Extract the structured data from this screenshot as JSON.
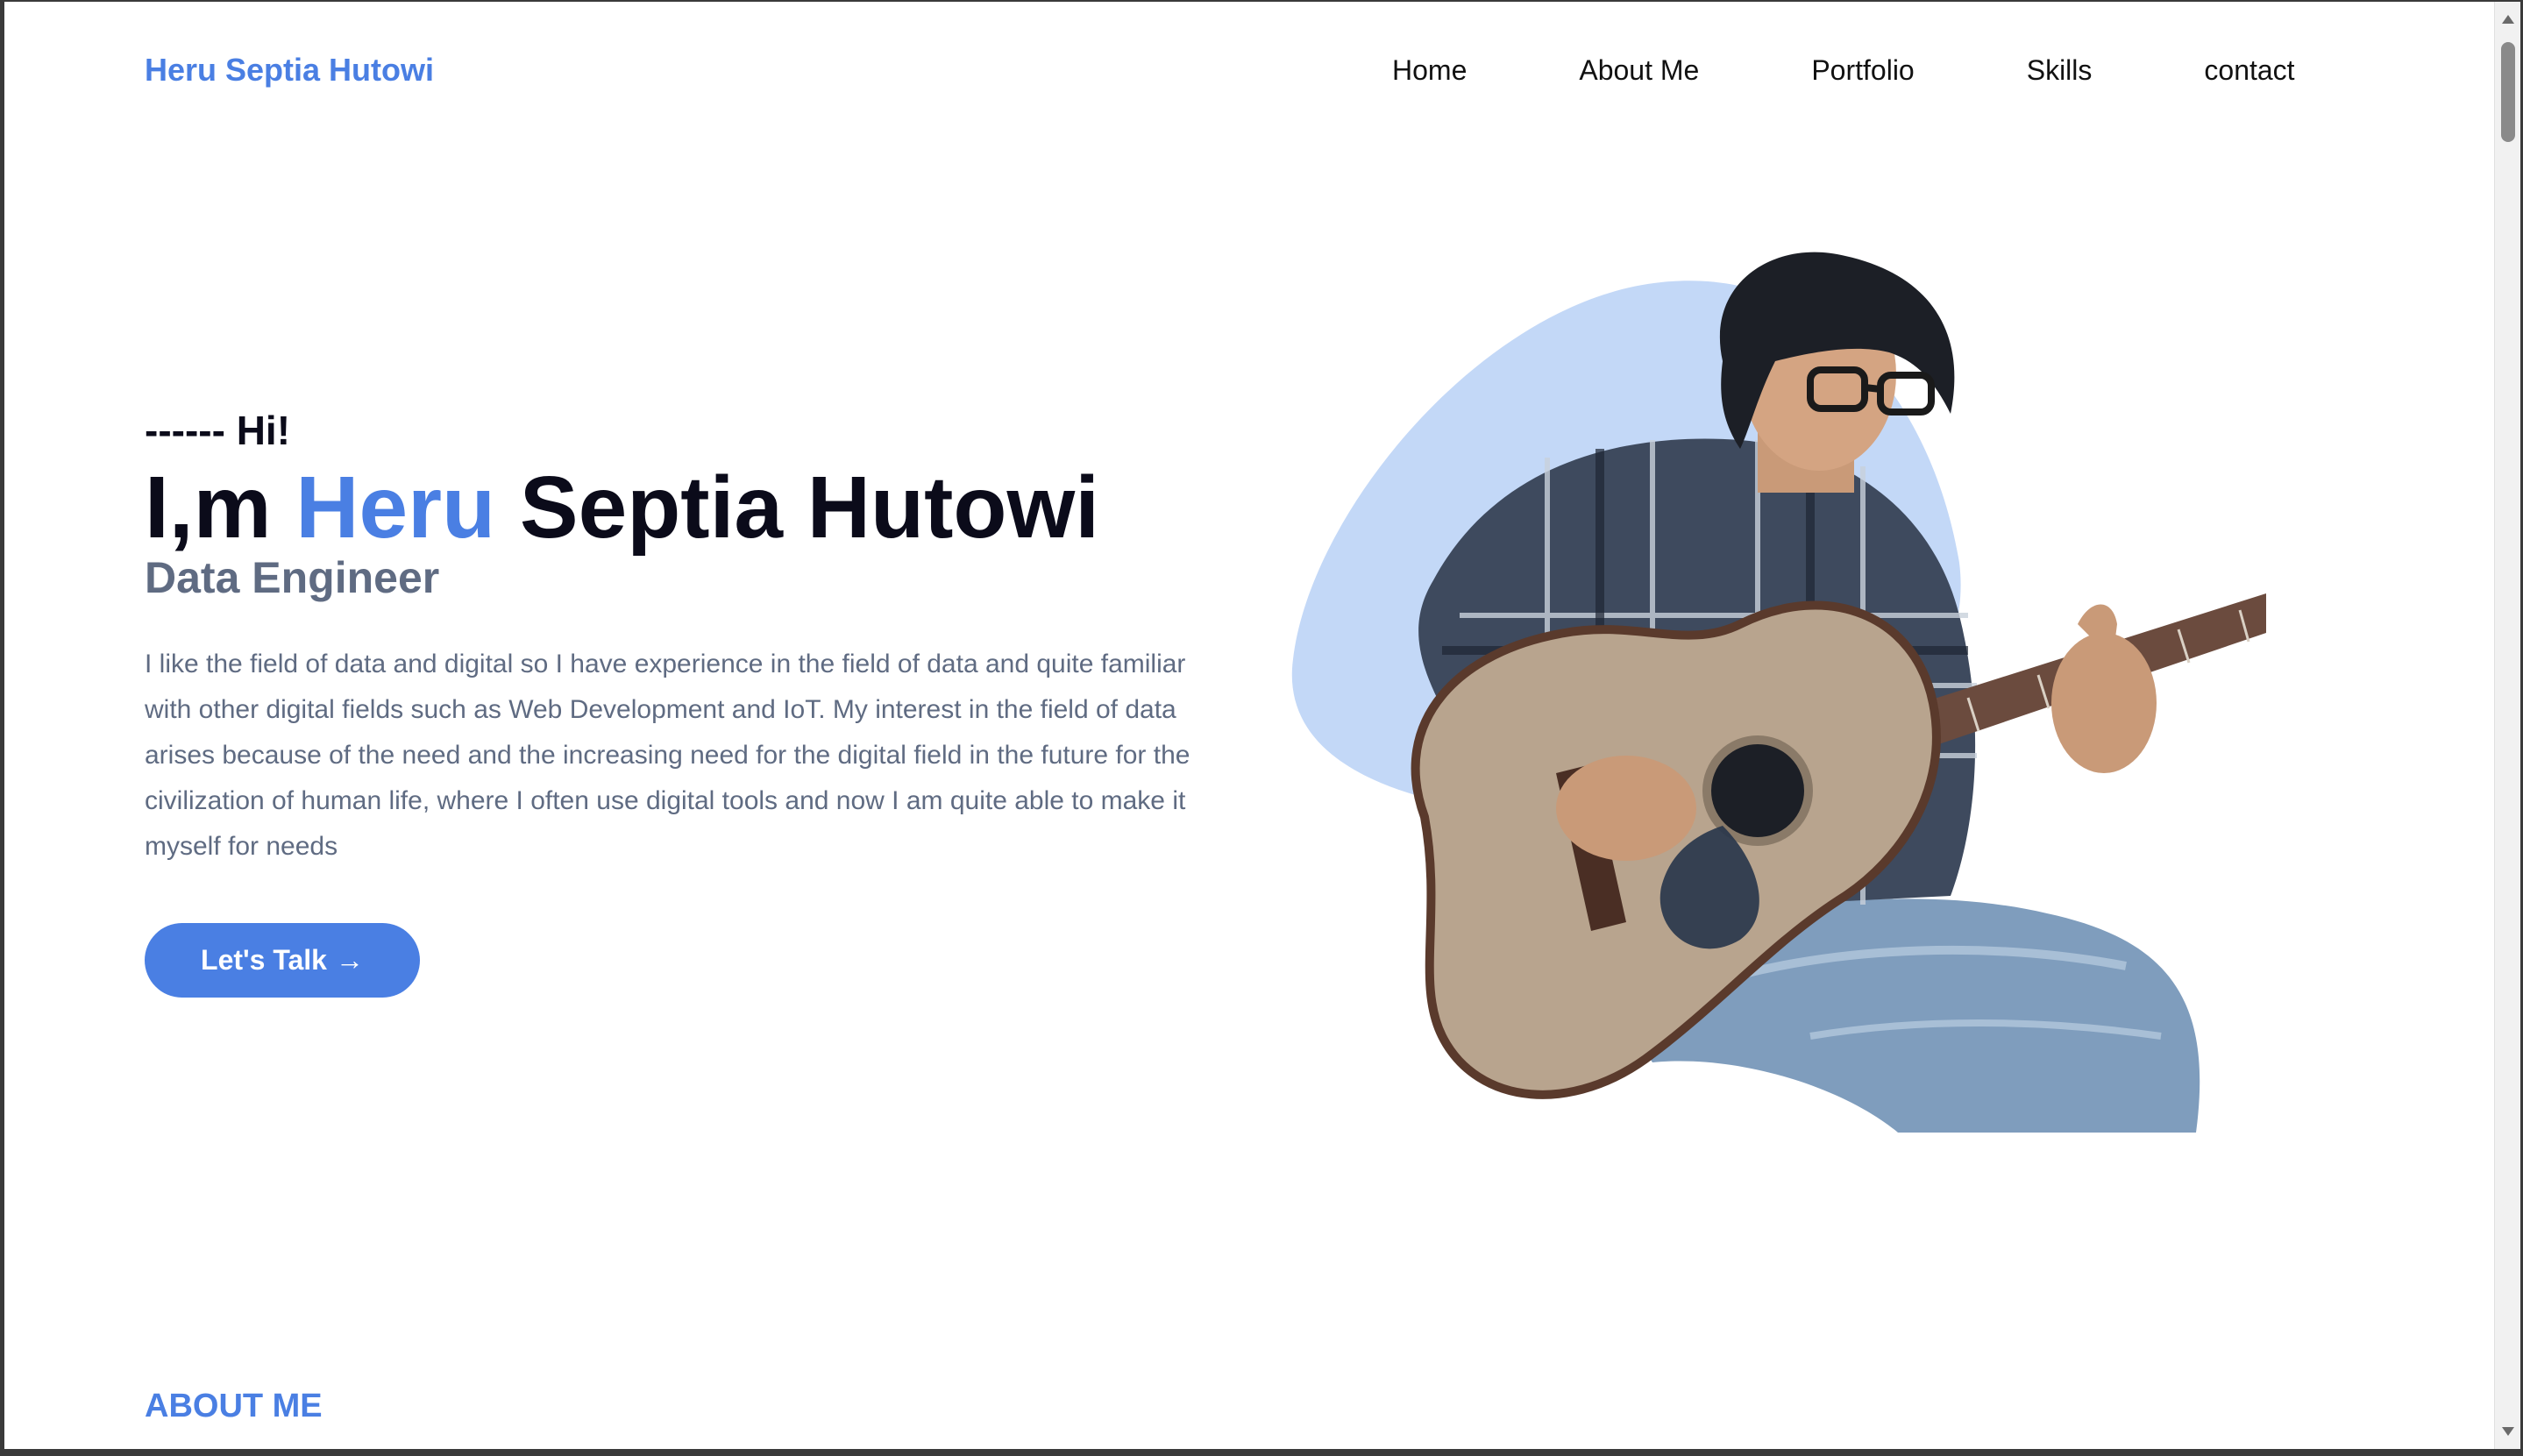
{
  "header": {
    "brand": "Heru Septia Hutowi",
    "nav": [
      "Home",
      "About Me",
      "Portfolio",
      "Skills",
      "contact"
    ]
  },
  "hero": {
    "greeting": "------ Hi!",
    "headline_prefix": "I,m ",
    "headline_accent": "Heru",
    "headline_suffix": " Septia Hutowi",
    "role": "Data Engineer",
    "bio": "I like the field of data and digital so I have experience in the field of data and quite familiar with other digital fields such as Web Development and IoT. My interest in the field of data arises because of the need and the increasing need for the digital field in the future for the civilization of human life, where I often use digital tools and now I am quite able to make it myself for needs",
    "cta_label": "Let's Talk",
    "cta_arrow": "→"
  },
  "about": {
    "heading": "ABOUT ME"
  },
  "colors": {
    "accent": "#4a7fe3",
    "blob": "#c3d8f7",
    "text_dark": "#0b0b1a",
    "text_muted": "#5f6b82"
  },
  "icons": {
    "scroll_up": "triangle-up-icon",
    "scroll_down": "triangle-down-icon",
    "cta_arrow": "arrow-right-icon"
  }
}
